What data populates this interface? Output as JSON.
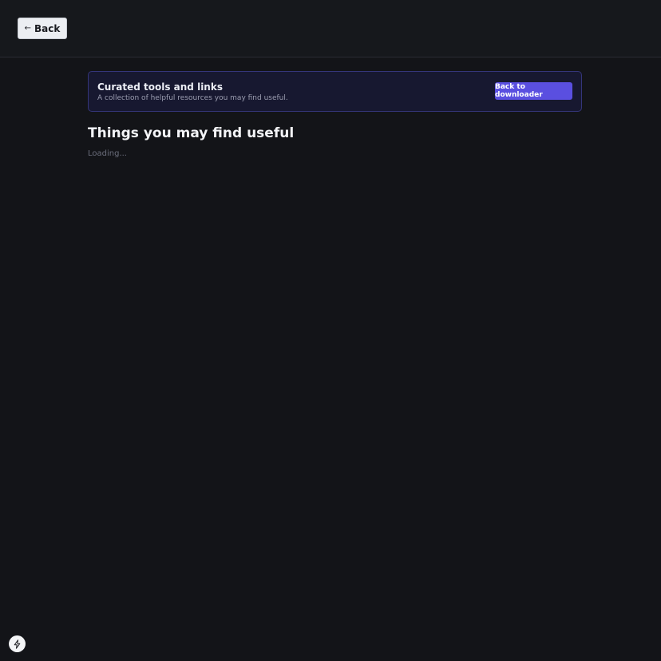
{
  "header": {
    "back_arrow": "←",
    "back_label": "Back"
  },
  "banner": {
    "title": "Curated tools and links",
    "subtitle": "A collection of helpful resources you may find useful.",
    "button_label": "Back to downloader"
  },
  "main": {
    "title": "Things you may find useful",
    "status": "Loading..."
  },
  "floating": {
    "icon": "bolt-icon"
  },
  "colors": {
    "background": "#131418",
    "accent": "#5a4fe0"
  }
}
